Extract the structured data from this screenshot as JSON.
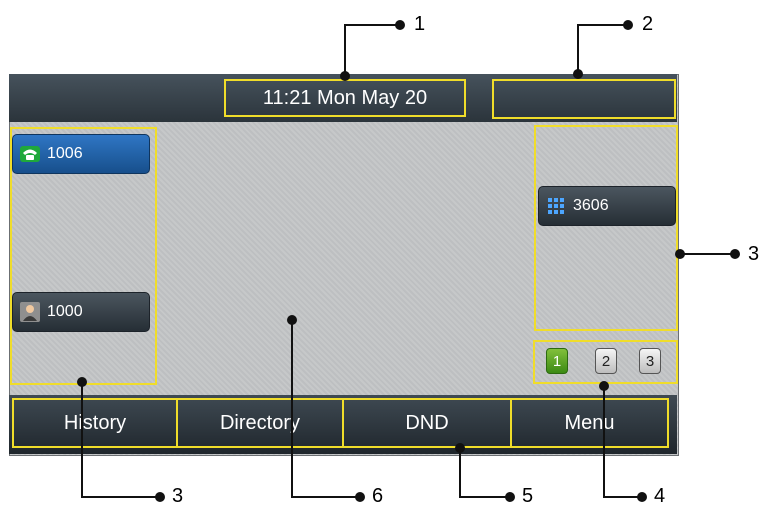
{
  "status_bar": {
    "time": "11:21 Mon May 20"
  },
  "left_keys": [
    {
      "label": "1006",
      "icon": "phone-icon",
      "state": "active"
    },
    {
      "label": "1000",
      "icon": "contact-icon",
      "state": "idle"
    }
  ],
  "right_keys": [
    {
      "label": "3606",
      "icon": "dialpad-icon",
      "state": "idle"
    }
  ],
  "pages": [
    {
      "label": "1",
      "active": true
    },
    {
      "label": "2",
      "active": false
    },
    {
      "label": "3",
      "active": false
    }
  ],
  "softkeys": [
    "History",
    "Directory",
    "DND",
    "Menu"
  ],
  "callouts": {
    "top_time": "1",
    "top_status": "2",
    "right_keys": "3",
    "left_keys": "3",
    "idle_area": "6",
    "softkeys": "5",
    "pages": "4"
  },
  "colors": {
    "highlight": "#f0dd2a",
    "active_key": "#2f76c4",
    "active_page": "#4ea21e",
    "phone_icon": "#1fa83b"
  }
}
